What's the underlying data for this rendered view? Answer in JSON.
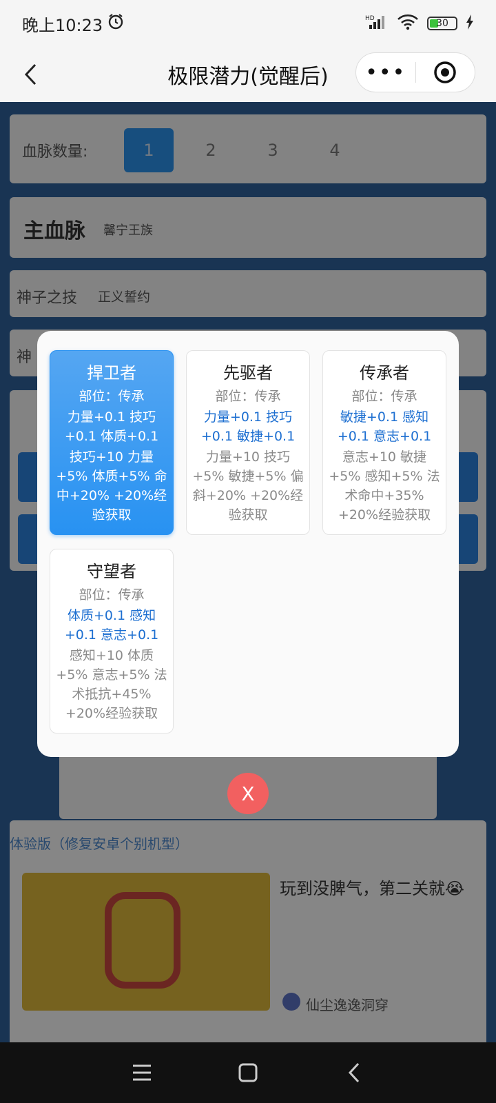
{
  "status": {
    "time": "晚上10:23",
    "network": "HD",
    "battery": "30"
  },
  "nav": {
    "title": "极限潜力(觉醒后)",
    "more": "•••"
  },
  "background": {
    "bloodline_count_label": "血脉数量:",
    "count_options": [
      "1",
      "2",
      "3",
      "4"
    ],
    "selected_count": "1",
    "main_bloodline_label": "主血脉",
    "main_bloodline_value": "馨宁王族",
    "skill_label": "神子之技",
    "skill_value": "正义誓约",
    "row3_label": "神",
    "ad_tag": "体验版（修复安卓个别机型）",
    "ad_title": "玩到没脾气，第二关就😭",
    "ad_author": "仙尘逸逸洞穿"
  },
  "dialog": {
    "cards": [
      {
        "name": "捍卫者",
        "part": "部位：传承",
        "stats": "力量+0.1 技巧+0.1 体质+0.1",
        "effect": "技巧+10 力量+5% 体质+5% 命中+20% +20%经验获取",
        "selected": true
      },
      {
        "name": "先驱者",
        "part": "部位：传承",
        "stats": "力量+0.1 技巧+0.1 敏捷+0.1",
        "effect": "力量+10 技巧+5% 敏捷+5% 偏斜+20% +20%经验获取",
        "selected": false
      },
      {
        "name": "传承者",
        "part": "部位：传承",
        "stats": "敏捷+0.1 感知+0.1 意志+0.1",
        "effect": "意志+10 敏捷+5% 感知+5% 法术命中+35% +20%经验获取",
        "selected": false
      },
      {
        "name": "守望者",
        "part": "部位：传承",
        "stats": "体质+0.1 感知+0.1 意志+0.1",
        "effect": "感知+10 体质+5% 意志+5% 法术抵抗+45% +20%经验获取",
        "selected": false
      }
    ],
    "close_label": "X"
  },
  "colors": {
    "accent": "#2892f2",
    "stat_blue": "#1d6fd1",
    "close_red": "#f26060"
  }
}
